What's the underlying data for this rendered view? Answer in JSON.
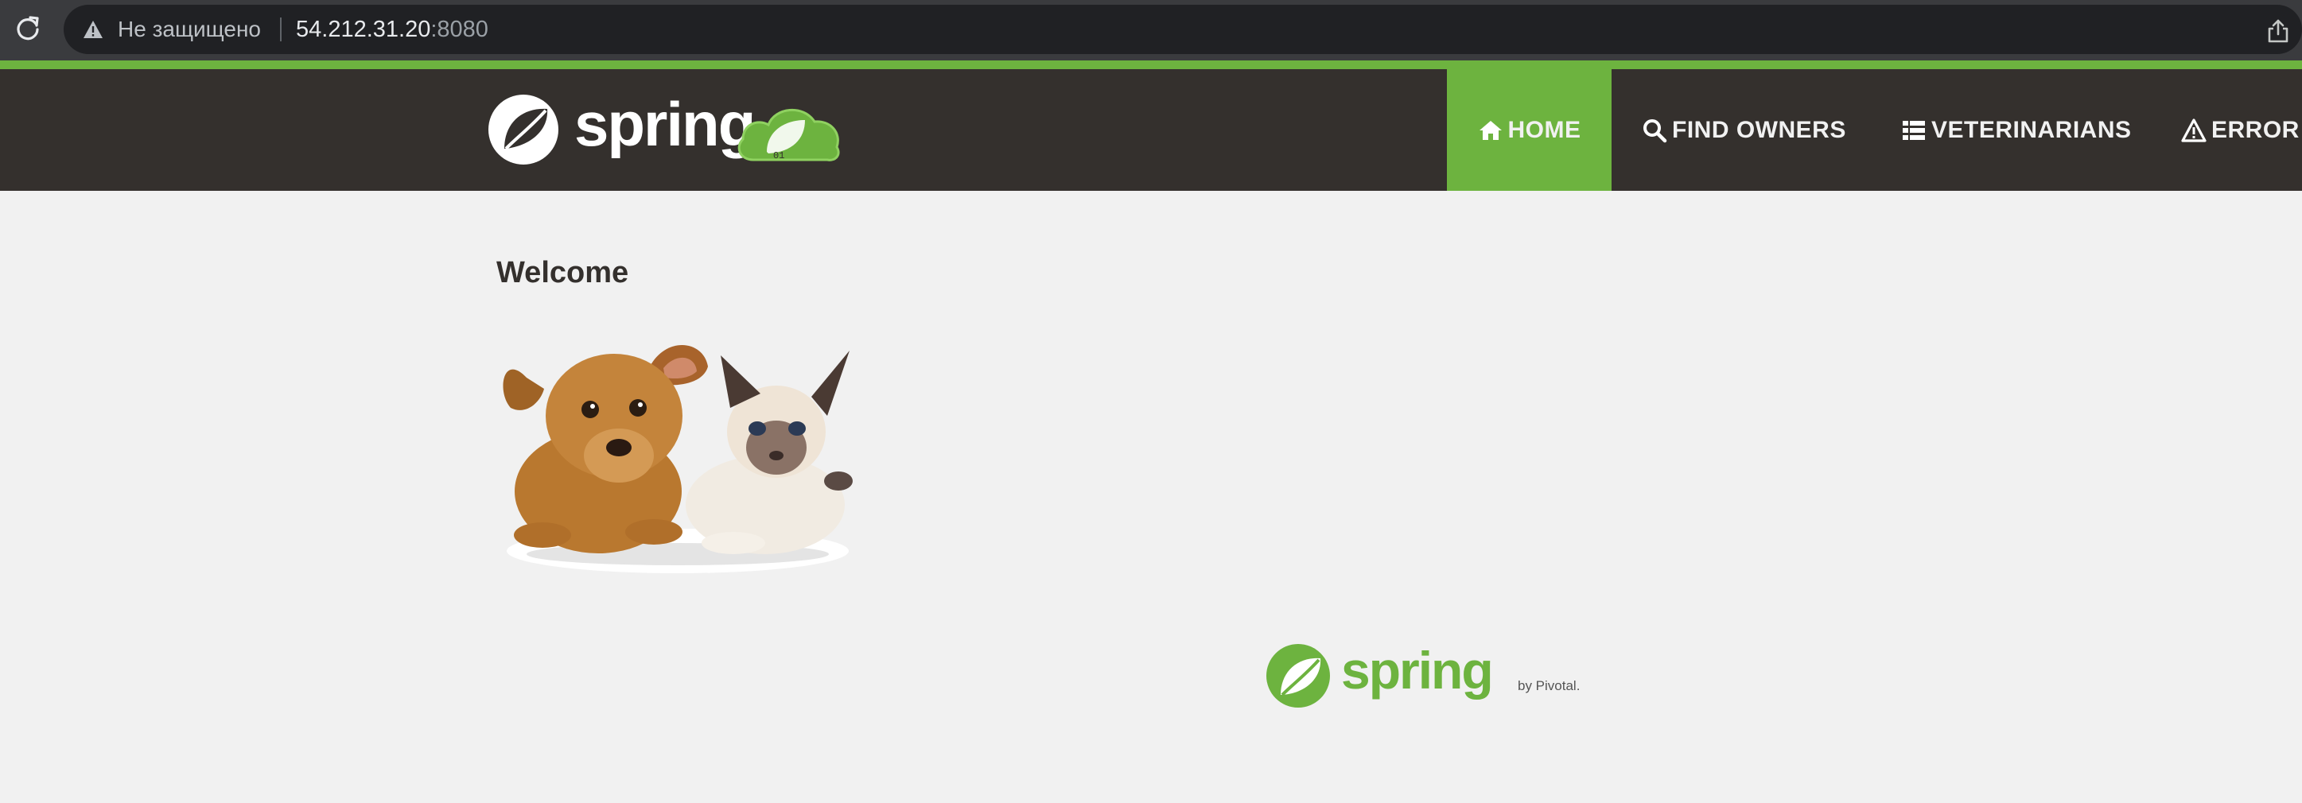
{
  "browser": {
    "security_label": "Не защищено",
    "url_host": "54.212.31.20",
    "url_port": ":8080",
    "icons": [
      "reload-icon",
      "warning-icon",
      "share-icon",
      "bookmark-star-icon"
    ]
  },
  "theme": {
    "accent": "#6db33f",
    "navbar_bg": "#34302d",
    "page_bg": "#f1f1f1"
  },
  "nav": {
    "home": "HOME",
    "find_owners": "FIND OWNERS",
    "veterinarians": "VETERINARIANS",
    "error": "ERROR",
    "active": "HOME",
    "icons": [
      "home-icon",
      "search-icon",
      "list-icon",
      "warning-icon"
    ]
  },
  "brand": {
    "logo_text": "spring"
  },
  "main": {
    "title": "Welcome",
    "image_alt": "pets"
  },
  "footer": {
    "logo_text": "spring",
    "byline": "by Pivotal."
  }
}
